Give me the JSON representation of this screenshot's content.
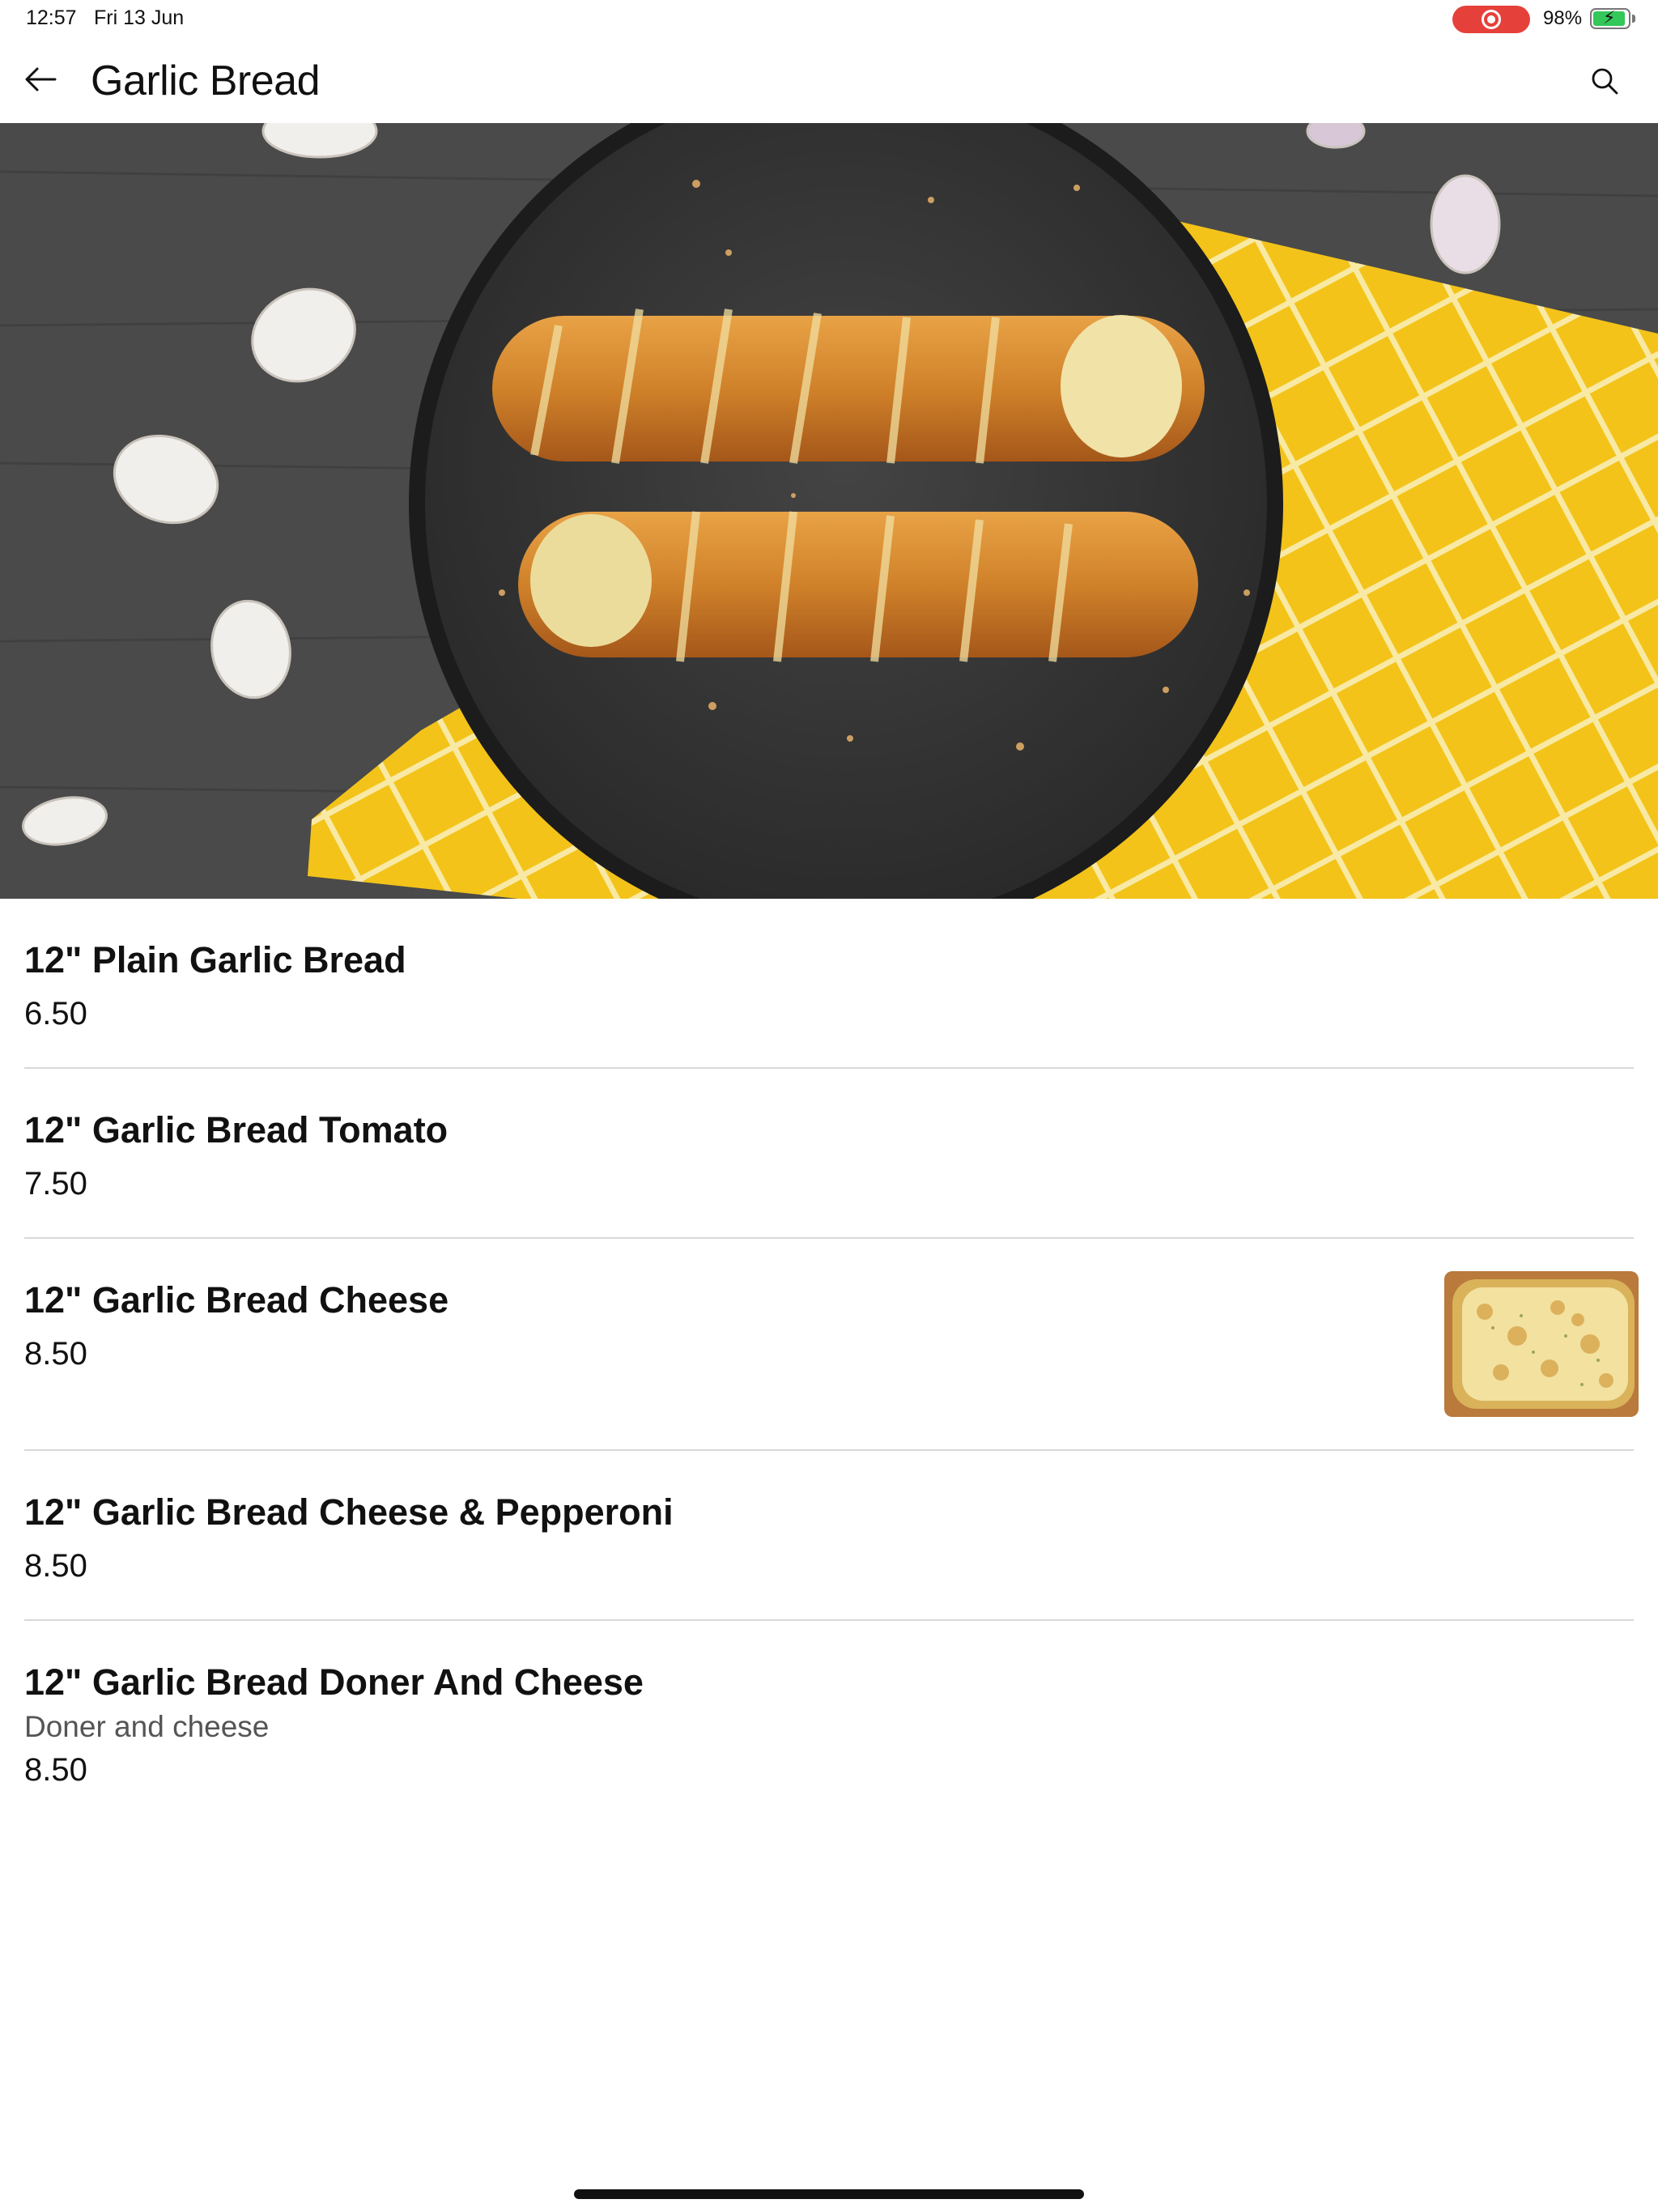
{
  "status_bar": {
    "time": "12:57",
    "date": "Fri 13 Jun",
    "battery": "98%",
    "battery_level": 0.98
  },
  "header": {
    "title": "Garlic Bread",
    "back_icon": "arrow-left-icon",
    "search_icon": "search-icon"
  },
  "hero": {
    "image": "garlic-bread-photo"
  },
  "items": [
    {
      "name": "12\" Plain Garlic Bread",
      "price": "6.50"
    },
    {
      "name": "12\" Garlic Bread Tomato",
      "price": "7.50"
    },
    {
      "name": "12\" Garlic Bread Cheese",
      "price": "8.50",
      "thumbnail": "cheese-garlic-bread-photo"
    },
    {
      "name": "12\" Garlic Bread Cheese & Pepperoni",
      "price": "8.50"
    },
    {
      "name": "12\" Garlic Bread Doner And Cheese",
      "description": "Doner and cheese",
      "price": "8.50"
    }
  ],
  "colors": {
    "record_pill": "#e5413a",
    "battery_fill": "#34c759",
    "divider": "#d8d8d8",
    "towel": "#f3c319",
    "board": "#3d3d3d"
  }
}
